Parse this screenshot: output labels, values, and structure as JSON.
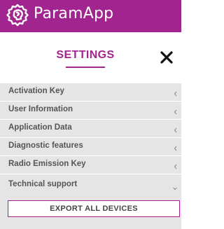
{
  "app": {
    "title": "ParamApp",
    "brand_color": "#a1248f",
    "logo_icon": "gear-head-icon"
  },
  "settings": {
    "title": "SETTINGS",
    "close_icon": "close-icon"
  },
  "menu": {
    "items": [
      {
        "label": "Activation Key",
        "state": "collapsed"
      },
      {
        "label": "User Information",
        "state": "collapsed"
      },
      {
        "label": "Application Data",
        "state": "collapsed"
      },
      {
        "label": "Diagnostic features",
        "state": "collapsed"
      },
      {
        "label": "Radio Emission Key",
        "state": "collapsed"
      }
    ],
    "expanded": {
      "label": "Technical support",
      "state": "expanded",
      "button_label": "EXPORT ALL DEVICES"
    }
  },
  "colors": {
    "row_background": "#e5e5e5",
    "text": "#555555"
  }
}
